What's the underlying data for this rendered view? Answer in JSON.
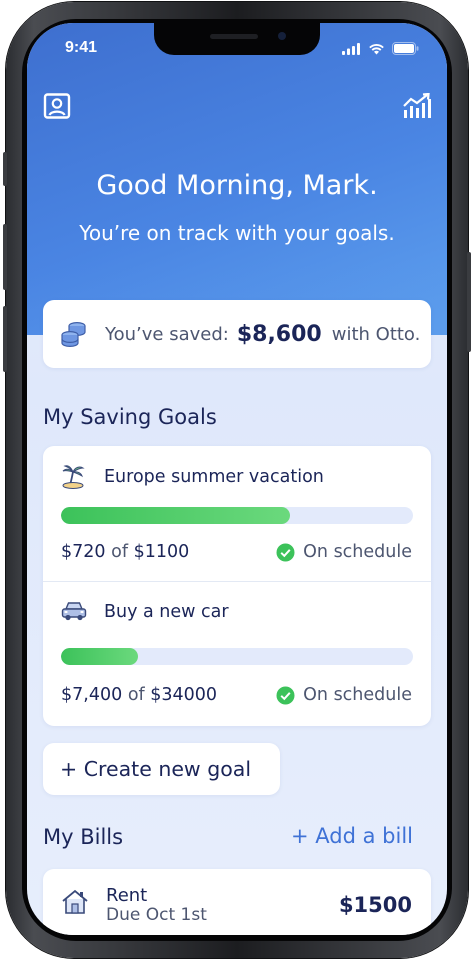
{
  "status_bar": {
    "time": "9:41"
  },
  "header": {
    "profile_icon": "profile-icon",
    "chart_icon": "growth-chart-icon",
    "greeting": "Good Morning, Mark.",
    "subtitle": "You’re on track with your goals."
  },
  "savings": {
    "icon": "coins-icon",
    "prefix": "You’ve saved:",
    "amount": "$8,600",
    "suffix": "with Otto."
  },
  "goals_section": {
    "title": "My Saving Goals",
    "goals": [
      {
        "icon": "palm-island-icon",
        "name": "Europe summer vacation",
        "saved": "$720",
        "of": "of",
        "target": "$1100",
        "progress": 0.65,
        "status": "On schedule"
      },
      {
        "icon": "car-icon",
        "name": "Buy a new car",
        "saved": "$7,400",
        "of": "of",
        "target": "$34000",
        "progress": 0.22,
        "status": "On schedule"
      }
    ]
  },
  "create_goal": {
    "label": "+ Create new goal"
  },
  "bills_section": {
    "title": "My Bills",
    "add_label": "+ Add a bill",
    "bills": [
      {
        "icon": "house-icon",
        "name": "Rent",
        "due": "Due Oct 1st",
        "amount": "$1500"
      }
    ]
  },
  "colors": {
    "accent": "#3f72d6",
    "text_primary": "#1b2558",
    "progress_green": "#3cc25a",
    "hero_blue": "#4a85e3"
  }
}
